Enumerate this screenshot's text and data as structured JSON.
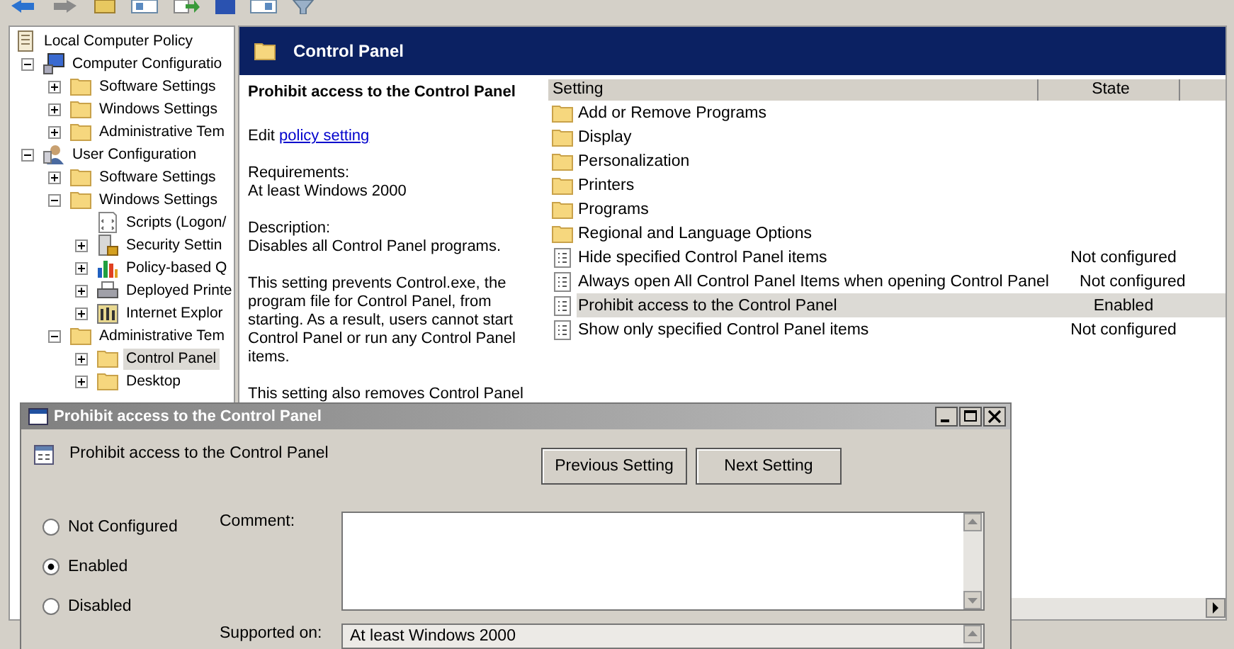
{
  "tree": {
    "items": [
      {
        "kind": "root",
        "label": "Local Computer Policy",
        "selected": false,
        "children": [
          {
            "kind": "computer",
            "label": "Computer Configuratio",
            "expanded": true,
            "selected": false,
            "children": [
              {
                "kind": "folder",
                "label": "Software Settings",
                "expanded": false,
                "selected": false
              },
              {
                "kind": "folder",
                "label": "Windows Settings",
                "expanded": false,
                "selected": false
              },
              {
                "kind": "folder",
                "label": "Administrative Tem",
                "expanded": false,
                "selected": false
              }
            ]
          },
          {
            "kind": "user",
            "label": "User Configuration",
            "expanded": true,
            "selected": false,
            "children": [
              {
                "kind": "folder",
                "label": "Software Settings",
                "expanded": false,
                "selected": false
              },
              {
                "kind": "folder",
                "label": "Windows Settings",
                "expanded": true,
                "selected": false,
                "children": [
                  {
                    "kind": "scripts",
                    "label": "Scripts (Logon/",
                    "selected": false
                  },
                  {
                    "kind": "security",
                    "label": "Security Settin",
                    "expanded": false,
                    "selected": false
                  },
                  {
                    "kind": "qos",
                    "label": "Policy-based Q",
                    "expanded": false,
                    "selected": false
                  },
                  {
                    "kind": "printers",
                    "label": "Deployed Printe",
                    "expanded": false,
                    "selected": false
                  },
                  {
                    "kind": "ie",
                    "label": "Internet Explor",
                    "expanded": false,
                    "selected": false
                  }
                ]
              },
              {
                "kind": "folder",
                "label": "Administrative Tem",
                "expanded": true,
                "selected": false,
                "children": [
                  {
                    "kind": "folder",
                    "label": "Control Panel",
                    "expanded": false,
                    "selected": true
                  },
                  {
                    "kind": "folder",
                    "label": "Desktop",
                    "expanded": false,
                    "selected": false
                  }
                ]
              }
            ]
          }
        ]
      }
    ]
  },
  "header": {
    "title": "Control Panel"
  },
  "description": {
    "title": "Prohibit access to the Control Panel",
    "edit_prefix": "Edit",
    "edit_link": "policy setting",
    "paragraphs": [
      [
        "Requirements:",
        "At least Windows 2000"
      ],
      [
        "Description:",
        "Disables all Control Panel programs."
      ],
      [
        "This setting prevents Control.exe, the program file for Control Panel, from starting. As a result, users cannot start Control Panel or run any Control Panel items."
      ],
      [
        "This setting also removes Control Panel"
      ]
    ]
  },
  "list": {
    "columns": [
      "Setting",
      "State"
    ],
    "rows": [
      {
        "kind": "folder",
        "name": "Add or Remove Programs",
        "selected": false
      },
      {
        "kind": "folder",
        "name": "Display",
        "selected": false
      },
      {
        "kind": "folder",
        "name": "Personalization",
        "selected": false
      },
      {
        "kind": "folder",
        "name": "Printers",
        "selected": false
      },
      {
        "kind": "folder",
        "name": "Programs",
        "selected": false
      },
      {
        "kind": "folder",
        "name": "Regional and Language Options",
        "selected": false
      },
      {
        "kind": "policy",
        "name": "Hide specified Control Panel items",
        "state": "Not configured",
        "selected": false
      },
      {
        "kind": "policy",
        "name": "Always open All Control Panel Items when opening Control Panel",
        "state": "Not configured",
        "selected": false
      },
      {
        "kind": "policy",
        "name": "Prohibit access to the Control Panel",
        "state": "Enabled",
        "selected": true
      },
      {
        "kind": "policy",
        "name": "Show only specified Control Panel items",
        "state": "Not configured",
        "selected": false
      }
    ]
  },
  "dialog": {
    "title": "Prohibit access to the Control Panel",
    "setting_name": "Prohibit access to the Control Panel",
    "buttons": [
      "Previous Setting",
      "Next Setting"
    ],
    "options": [
      {
        "label": "Not Configured",
        "selected": false
      },
      {
        "label": "Enabled",
        "selected": true
      },
      {
        "label": "Disabled",
        "selected": false
      }
    ],
    "comment_label": "Comment:",
    "supported_label": "Supported on:",
    "supported_value": "At least Windows 2000"
  }
}
